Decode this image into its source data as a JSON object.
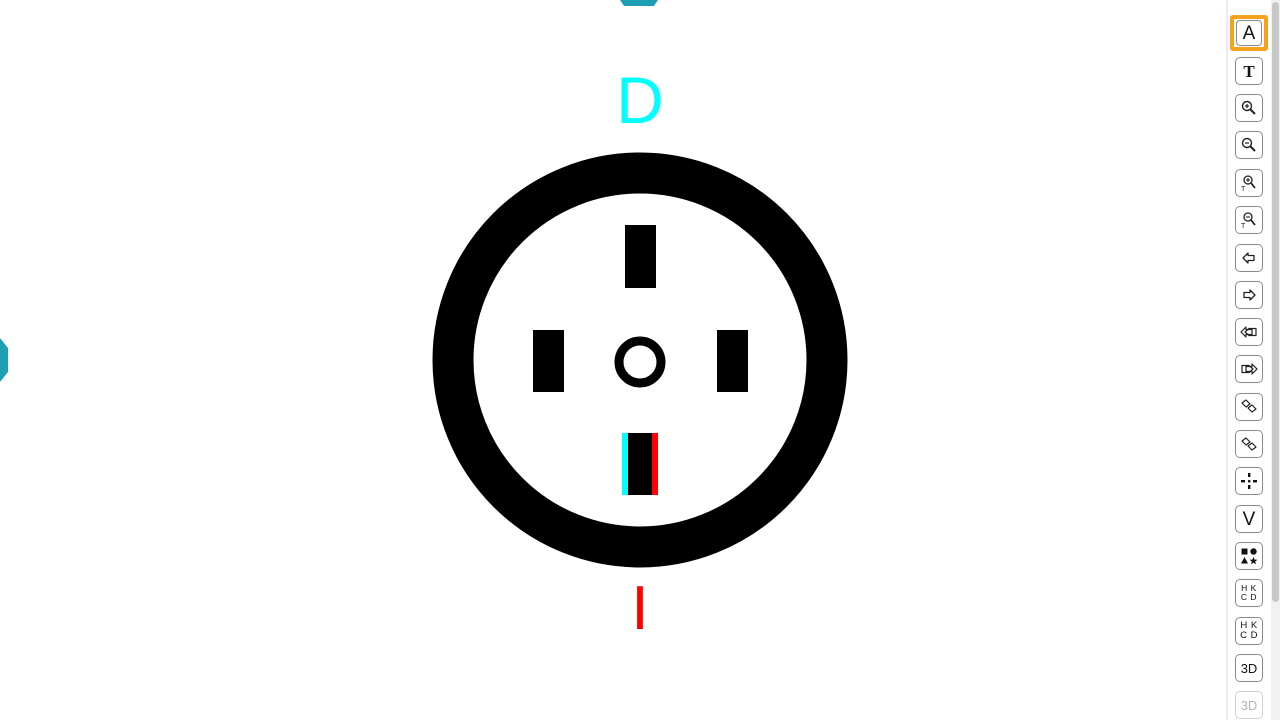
{
  "canvas": {
    "letter_top": "D",
    "letter_bottom": "I",
    "colors": {
      "cyan": "#00ffff",
      "red": "#ff0000",
      "teal_marker": "#1e9fb4",
      "ink": "#000000",
      "accent": "#f7a21b"
    }
  },
  "toolbar": {
    "tools": [
      {
        "id": "letter-a",
        "label": "A",
        "icon": "letter-a-icon",
        "active": true
      },
      {
        "id": "letter-t",
        "label": "T",
        "icon": "letter-t-icon"
      },
      {
        "id": "zoom-in",
        "label": "",
        "icon": "zoom-in-icon"
      },
      {
        "id": "zoom-out",
        "label": "",
        "icon": "zoom-out-icon"
      },
      {
        "id": "text-zoom-in",
        "label": "",
        "icon": "text-zoom-in-icon"
      },
      {
        "id": "text-zoom-out",
        "label": "",
        "icon": "text-zoom-out-icon"
      },
      {
        "id": "arrow-left",
        "label": "",
        "icon": "arrow-left-icon"
      },
      {
        "id": "arrow-right",
        "label": "",
        "icon": "arrow-right-icon"
      },
      {
        "id": "double-arrow-left",
        "label": "",
        "icon": "double-arrow-left-icon"
      },
      {
        "id": "double-arrow-right",
        "label": "",
        "icon": "double-arrow-right-icon"
      },
      {
        "id": "rotate-cw",
        "label": "",
        "icon": "rotate-clockwise-icon"
      },
      {
        "id": "rotate-ccw",
        "label": "",
        "icon": "rotate-counterclockwise-icon"
      },
      {
        "id": "cross-target",
        "label": "",
        "icon": "cross-target-icon"
      },
      {
        "id": "letter-v",
        "label": "V",
        "icon": "letter-v-icon"
      },
      {
        "id": "shapes",
        "label": "",
        "icon": "shapes-icon"
      },
      {
        "id": "hkcd-small",
        "label": "H K\nC D",
        "icon": "hkcd-small-icon"
      },
      {
        "id": "hkcd",
        "label": "H K\nC D",
        "icon": "hkcd-icon"
      },
      {
        "id": "three-d",
        "label": "3D",
        "icon": "three-d-icon"
      },
      {
        "id": "three-d-anim",
        "label": "3D",
        "icon": "three-d-animated-icon",
        "disabled": true
      }
    ]
  }
}
